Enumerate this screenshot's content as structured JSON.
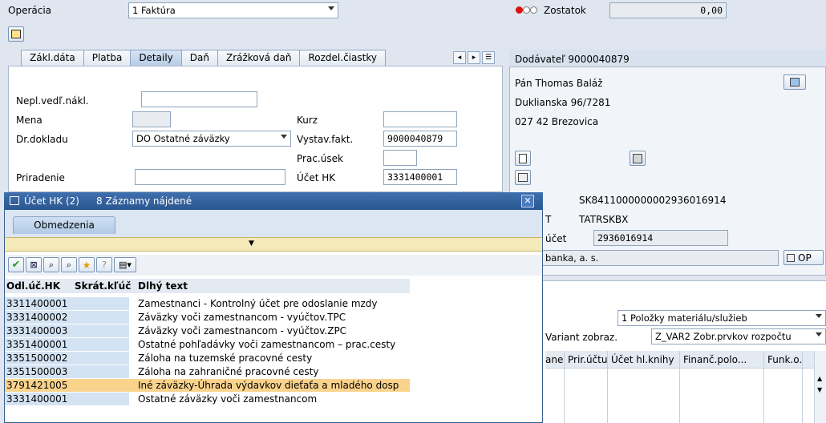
{
  "header": {
    "operation_label": "Operácia",
    "operation_value": "1 Faktúra",
    "balance_label": "Zostatok",
    "balance_value": "0,00"
  },
  "tabs": [
    "Zákl.dáta",
    "Platba",
    "Detaily",
    "Daň",
    "Zrážková daň",
    "Rozdel.čiastky"
  ],
  "details": {
    "nepl_label": "Nepl.vedľ.nákl.",
    "nepl_value": "",
    "mena_label": "Mena",
    "mena_value": "",
    "kurz_label": "Kurz",
    "kurz_value": "",
    "drdokladu_label": "Dr.dokladu",
    "drdokladu_value": "DO Ostatné záväzky",
    "vystav_label": "Vystav.fakt.",
    "vystav_value": "9000040879",
    "pracusek_label": "Prac.úsek",
    "pracusek_value": "",
    "priradenie_label": "Priradenie",
    "priradenie_value": "",
    "ucethk_label": "Účet HK",
    "ucethk_value": "3331400001"
  },
  "vendor": {
    "title": "Dodávateľ 9000040879",
    "name": "Pán Thomas Baláž",
    "street": "Duklianska 96/7281",
    "city": "027 42 Brezovica",
    "iban": "SK8411000000002936016914",
    "swift_prefix": "T",
    "swift": "TATRSKBX",
    "account_label": "účet",
    "account": "2936016914",
    "bank": "banka, a. s.",
    "op_label": "OP"
  },
  "items": {
    "select_value": "1 Položky materiálu/služieb",
    "variant_label": "Variant zobraz.",
    "variant_value": "Z_VAR2 Zobr.prvkov rozpočtu",
    "columns": [
      "ane",
      "Prir.účtu",
      "Účet hl.knihy",
      "Finanč.polo...",
      "Funk.o."
    ]
  },
  "popup": {
    "title": "Účet HK (2)",
    "count": "8 Záznamy nájdené",
    "restrict_tab": "Obmedzenia",
    "col1": "Odl.úč.HK",
    "col2": "Skrát.kľúč",
    "col3": "Dlhý text",
    "rows": [
      {
        "acct": "3311400001",
        "text": "Zamestnanci - Kontrolný účet pre odoslanie mzdy"
      },
      {
        "acct": "3331400002",
        "text": "Záväzky voči zamestnancom - vyúčtov.TPC"
      },
      {
        "acct": "3331400003",
        "text": "Záväzky voči zamestnancom - vyúčtov.ZPC"
      },
      {
        "acct": "3351400001",
        "text": "Ostatné pohľadávky voči zamestnancom – prac.cesty"
      },
      {
        "acct": "3351500002",
        "text": "Záloha na tuzemské pracovné cesty"
      },
      {
        "acct": "3351500003",
        "text": "Záloha na zahraničné pracovné cesty"
      },
      {
        "acct": "3791421005",
        "text": "Iné záväzky-Úhrada výdavkov dieťaťa a mladého dosp"
      },
      {
        "acct": "3331400001",
        "text": "Ostatné záväzky voči zamestnancom"
      }
    ]
  },
  "colors": {
    "accent": "#1f4e8c",
    "selection": "#f9d38c",
    "key_cell": "#d4e3f3"
  }
}
